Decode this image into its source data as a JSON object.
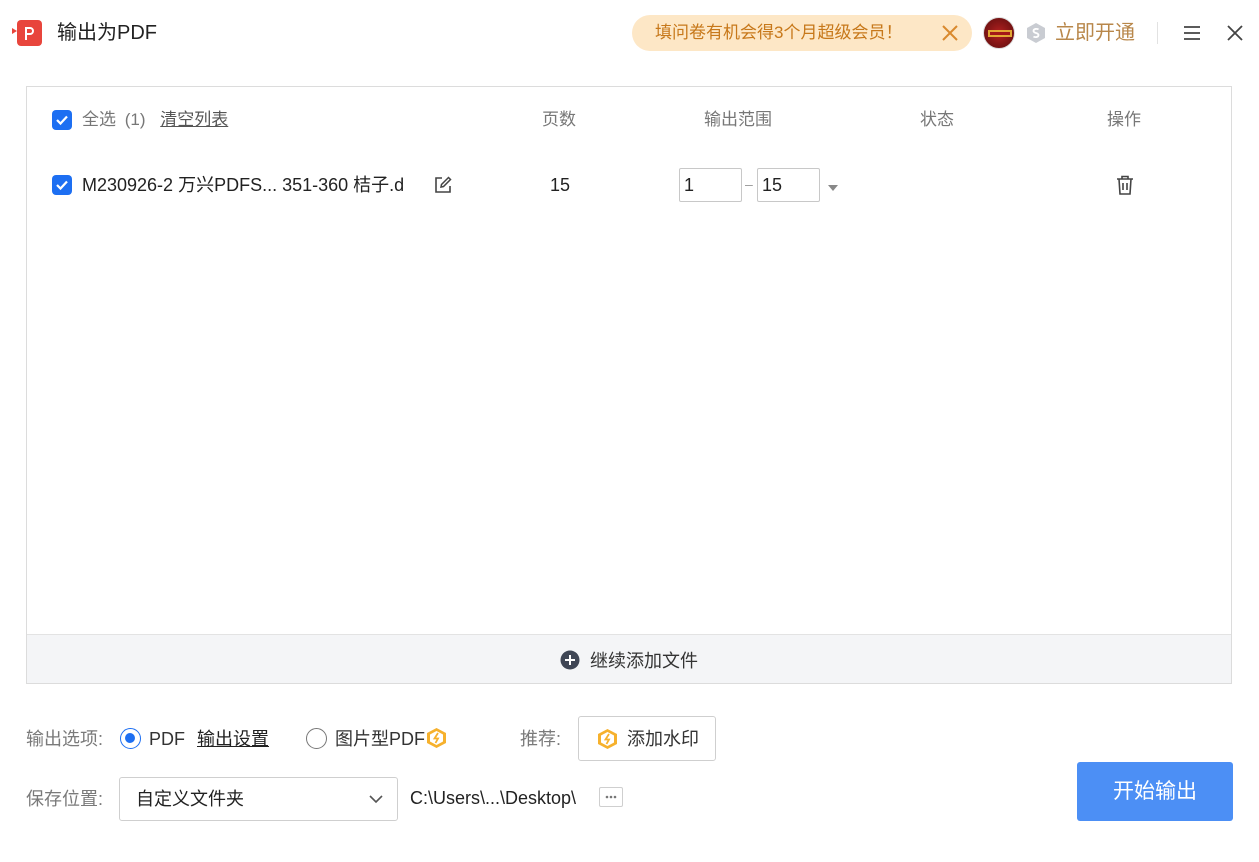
{
  "window": {
    "title": "输出为PDF",
    "promo_text": "填问卷有机会得3个月超级会员！",
    "open_now": "立即开通",
    "brand_color": "#e8453c",
    "accent_color": "#1d6ff2"
  },
  "table": {
    "select_all_label": "全选",
    "select_all_count": "(1)",
    "clear_list": "清空列表",
    "headers": {
      "pages": "页数",
      "range": "输出范围",
      "status": "状态",
      "actions": "操作"
    },
    "rows": [
      {
        "name": "M230926-2 万兴PDFS... 351-360 桔子.d",
        "pages": "15",
        "range_from": "1",
        "range_to": "15",
        "status": ""
      }
    ]
  },
  "add_more": "继续添加文件",
  "options": {
    "label": "输出选项:",
    "pdf": "PDF",
    "settings": "输出设置",
    "image_pdf": "图片型PDF",
    "recommend_label": "推荐:",
    "watermark": "添加水印"
  },
  "save": {
    "label": "保存位置:",
    "folder_option": "自定义文件夹",
    "path": "C:\\Users\\...\\Desktop\\"
  },
  "start_button": "开始输出"
}
